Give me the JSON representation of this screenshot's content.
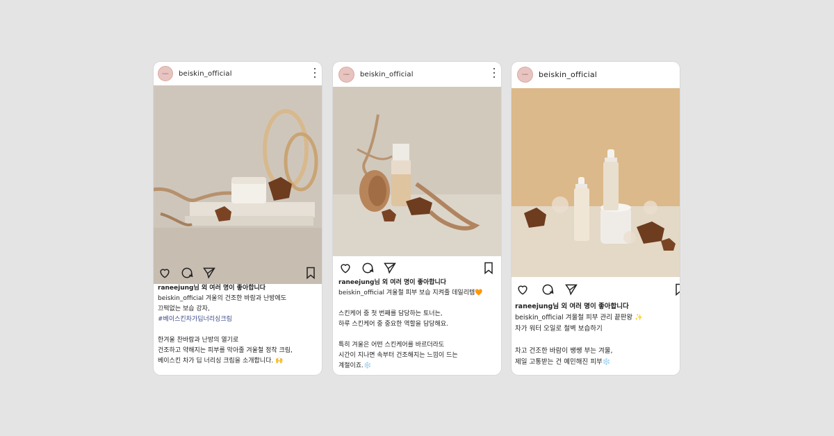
{
  "posts": [
    {
      "username": "beiskin_official",
      "avatar_text": "beiskin",
      "likes_text": "raneejung님 외 여러 명이 좋아합니다",
      "caption_lines": [
        "beiskin_official 겨울의 건조한 바람과 난방에도",
        "끄떡없는 보습 강자,",
        "#베이스킨차가딥너리싱크림",
        "",
        "한겨울 찬바람과 난방의 열기로",
        "건조하고 약해지는 피부를 막아줄 겨울철 정착 크림,",
        "베이스킨 차가 딥 너리싱 크림을 소개합니다. 🙌"
      ],
      "photo": {
        "bg": "#cfc6bb",
        "floor": "#c9bfb4",
        "product": "cream jar"
      }
    },
    {
      "username": "beiskin_official",
      "avatar_text": "beiskin",
      "likes_text": "raneejung님 외 여러 명이 좋아합니다",
      "caption_lines": [
        "beiskin_official 겨울철 피부 보습 지켜줄 데일리템🧡",
        "",
        "스킨케어 중 첫 번째를 담당하는 토너는,",
        "하루 스킨케어 중 중요한 역할을 담당해요.",
        "",
        "특히 겨울은 어떤 스킨케어를 바르더라도",
        "시간이 지나면 속부터 건조해지는 느낌이 드는",
        "계절이죠.❄️"
      ],
      "photo": {
        "bg": "#d2c9bd",
        "floor": "#dcd5ca",
        "product": "toner bottle"
      }
    },
    {
      "username": "beiskin_official",
      "avatar_text": "beiskin",
      "likes_text": "raneejung님 외 여러 명이 좋아합니다",
      "caption_lines": [
        "beiskin_official 겨울철 피부 관리 끝판왕 ✨",
        "차가 워터 오일로 철벽 보습하기",
        "",
        "차고 건조한 바람이 쌩쌩 부는 겨울,",
        "제일 고통받는 건 예민해진 피부❄️"
      ],
      "photo": {
        "bg": "#dcb98a",
        "floor": "#e4d8c7",
        "product": "serum bottles"
      }
    }
  ],
  "icons": [
    "heart-icon",
    "comment-icon",
    "share-icon",
    "bookmark-icon",
    "more-icon"
  ],
  "colors": {
    "background": "#e4e4e4",
    "card": "#ffffff",
    "avatar": "#e7c4c0",
    "hashtag": "#3b4a8a"
  }
}
